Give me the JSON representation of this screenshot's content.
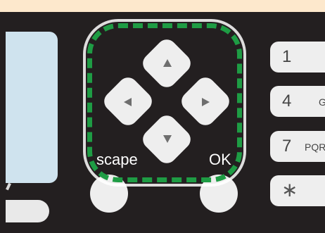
{
  "panel": {
    "escape_label": "scape",
    "ok_label": "OK"
  },
  "keypad": {
    "keys": [
      {
        "number": "1",
        "letters": ""
      },
      {
        "number": "4",
        "letters": "G"
      },
      {
        "number": "7",
        "letters": "PQR"
      },
      {
        "number": "∗",
        "letters": ""
      }
    ]
  },
  "dpad": {
    "up_icon": "arrow-up-icon",
    "down_icon": "arrow-down-icon",
    "left_icon": "arrow-left-icon",
    "right_icon": "arrow-right-icon"
  },
  "colors": {
    "background": "#fde8cc",
    "panel": "#231f20",
    "highlight": "#1e9c44",
    "lcd": "#cfe3ee",
    "button": "#eeeeee"
  }
}
